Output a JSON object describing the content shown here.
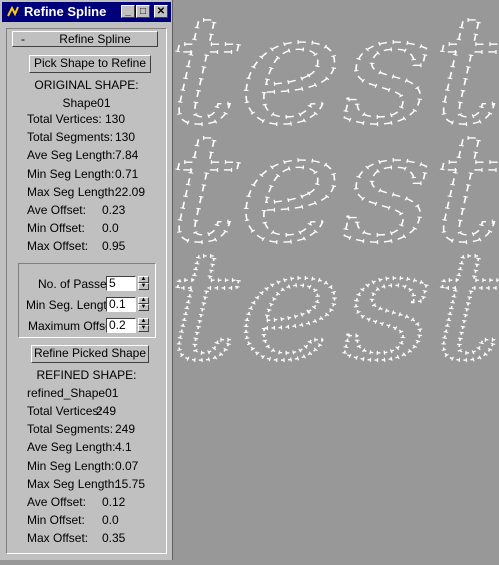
{
  "window": {
    "title": "Refine Spline",
    "min_glyph": "_",
    "max_glyph": "□",
    "close_glyph": "✕"
  },
  "rollout": {
    "toggle": "-",
    "title": "Refine Spline"
  },
  "pick_button": "Pick Shape to Refine",
  "original": {
    "heading": "ORIGINAL SHAPE:",
    "name": "Shape01",
    "stats": [
      {
        "label": "Total Vertices:",
        "value": "130"
      },
      {
        "label": "Total Segments:",
        "value": "130"
      },
      {
        "label": "Ave Seg Length:",
        "value": "7.84"
      },
      {
        "label": "Min Seg Length:",
        "value": "0.71"
      },
      {
        "label": "Max Seg Length:",
        "value": "22.09"
      },
      {
        "label": "Ave Offset:",
        "value": "0.23"
      },
      {
        "label": "Min Offset:",
        "value": "0.0"
      },
      {
        "label": "Max Offset:",
        "value": "0.95"
      }
    ]
  },
  "params": [
    {
      "label": "No. of Passes",
      "value": "5"
    },
    {
      "label": "Min Seg. Length",
      "value": "0.1"
    },
    {
      "label": "Maximum Offset",
      "value": "0.2"
    }
  ],
  "refine_button": "Refine Picked Shape",
  "refined": {
    "heading": "REFINED SHAPE:",
    "name": "refined_Shape01",
    "stats": [
      {
        "label": "Total Vertices:",
        "value": "249"
      },
      {
        "label": "Total Segments:",
        "value": "249"
      },
      {
        "label": "Ave Seg Length:",
        "value": "4.1"
      },
      {
        "label": "Min Seg Length:",
        "value": "0.07"
      },
      {
        "label": "Max Seg Length:",
        "value": "15.75"
      },
      {
        "label": "Ave Offset:",
        "value": "0.12"
      },
      {
        "label": "Min Offset:",
        "value": "0.0"
      },
      {
        "label": "Max Offset:",
        "value": "0.35"
      }
    ]
  },
  "viewport": {
    "rows": [
      "test",
      "test",
      "test"
    ]
  },
  "colors": {
    "titlebar": "#00007b",
    "panel": "#c0c0c0",
    "viewport": "#989898",
    "spline": "#ffffff"
  },
  "icons": [
    "app-icon",
    "minimize-icon",
    "maximize-icon",
    "close-icon",
    "spinner-up-icon",
    "spinner-down-icon"
  ]
}
